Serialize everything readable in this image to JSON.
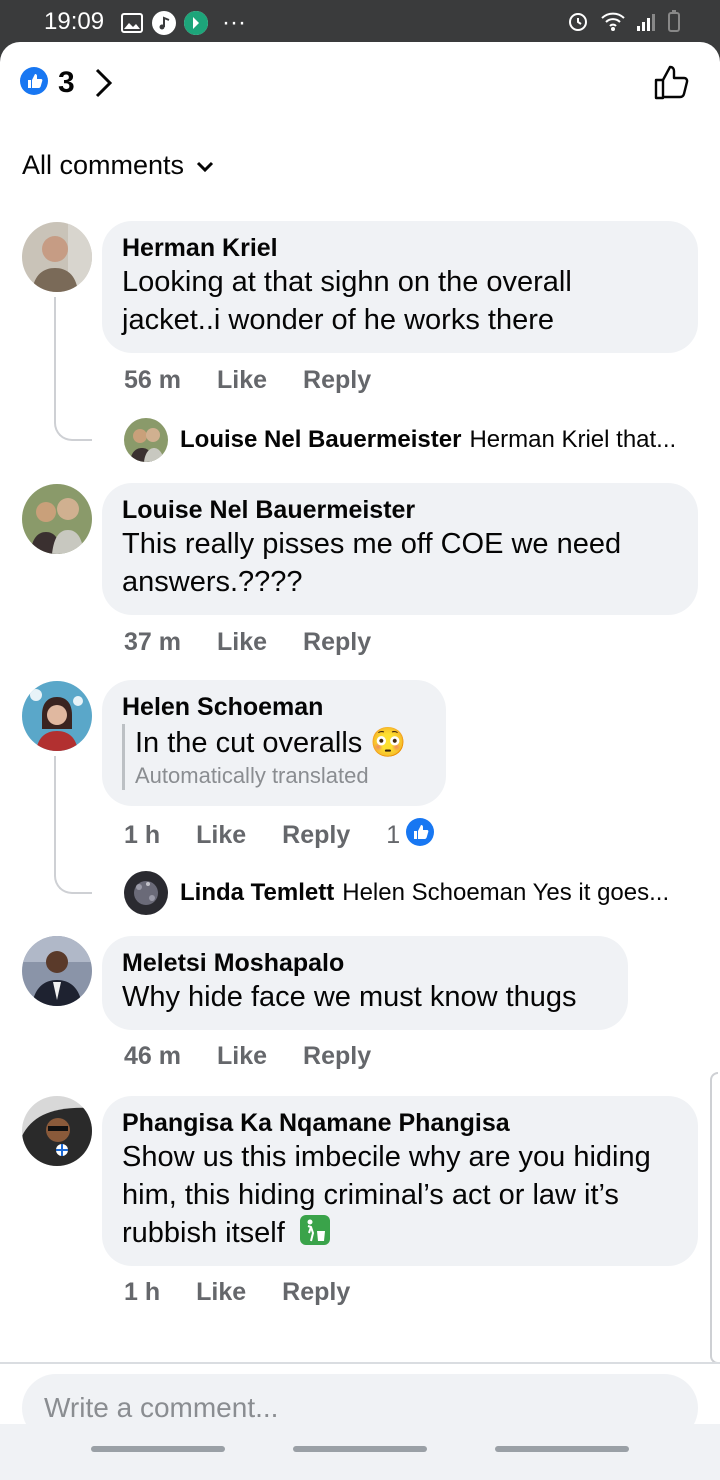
{
  "status_bar": {
    "time": "19:09",
    "more": "···"
  },
  "reactions": {
    "count": "3"
  },
  "filter": {
    "label": "All comments"
  },
  "composer": {
    "placeholder": "Write a comment..."
  },
  "comments": [
    {
      "author": "Herman Kriel",
      "text": "Looking at that sighn on the overall jacket..i wonder of he works there",
      "time": "56 m",
      "like": "Like",
      "reply": "Reply",
      "reply_preview": {
        "author": "Louise Nel Bauermeister",
        "text": "Herman Kriel that..."
      }
    },
    {
      "author": "Louise Nel Bauermeister",
      "text": "This really pisses me off COE we need answers.????",
      "time": "37 m",
      "like": "Like",
      "reply": "Reply"
    },
    {
      "author": "Helen Schoeman",
      "text": "In the cut overalls 😳",
      "translation_note": "Automatically translated",
      "time": "1 h",
      "like": "Like",
      "reply": "Reply",
      "like_count": "1",
      "reply_preview": {
        "author": "Linda Temlett",
        "text": "Helen Schoeman Yes it goes..."
      }
    },
    {
      "author": "Meletsi Moshapalo",
      "text": "Why hide face we must know thugs",
      "time": "46 m",
      "like": "Like",
      "reply": "Reply"
    },
    {
      "author": "Phangisa Ka Nqamane Phangisa",
      "text": "Show us this imbecile why are you hiding him, this hiding criminal’s act or law it’s rubbish itself",
      "time": "1 h",
      "like": "Like",
      "reply": "Reply"
    }
  ],
  "colors": {
    "accent": "#1877f2",
    "bubble": "#f0f2f5",
    "muted": "#65676b"
  }
}
